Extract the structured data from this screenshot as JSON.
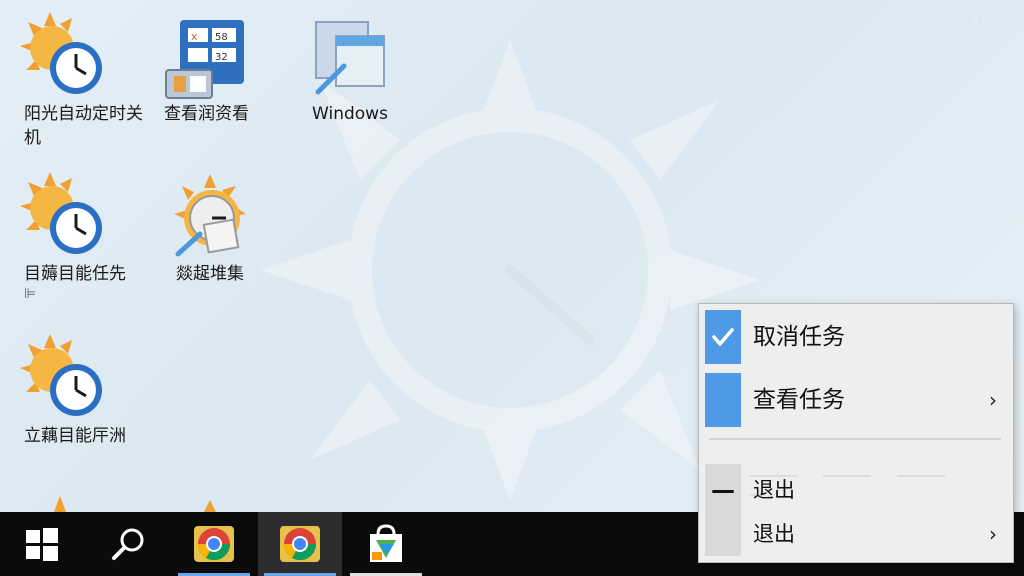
{
  "desktop": {
    "icons": [
      {
        "label": "阳光自动定时关机",
        "icon": "sun-clock-icon"
      },
      {
        "label": "查看润资看",
        "icon": "calculator-icon"
      },
      {
        "label": "Windows",
        "icon": "windows-window-icon"
      },
      {
        "label": "目薅目能任先",
        "icon": "sun-clock-icon",
        "sub": "⊫"
      },
      {
        "label": "燚趗堆集",
        "icon": "sun-clock-paper-icon"
      },
      {
        "label": "立藕目能厈洲",
        "icon": "sun-clock-icon"
      }
    ]
  },
  "taskbar": {
    "items": [
      {
        "name": "start-button",
        "icon": "windows-logo-icon"
      },
      {
        "name": "search-button",
        "icon": "search-icon"
      },
      {
        "name": "chrome-app-1",
        "icon": "chrome-icon"
      },
      {
        "name": "chrome-app-2",
        "icon": "chrome-icon"
      },
      {
        "name": "store-app",
        "icon": "store-bag-icon"
      }
    ]
  },
  "context_menu": {
    "items": [
      {
        "label": "取消任务",
        "checked": true,
        "has_submenu": false
      },
      {
        "label": "查看任务",
        "checked": false,
        "has_submenu": true
      },
      {
        "label": "退出",
        "checked": false,
        "has_submenu": false,
        "mark": "—"
      },
      {
        "label": "退出",
        "checked": false,
        "has_submenu": true
      }
    ],
    "arrow_glyph": "›",
    "check_glyph": "✓"
  },
  "colors": {
    "accent": "#4f9ae6",
    "menu_bg": "#eeeeee",
    "taskbar_bg": "#0b0b0c"
  }
}
